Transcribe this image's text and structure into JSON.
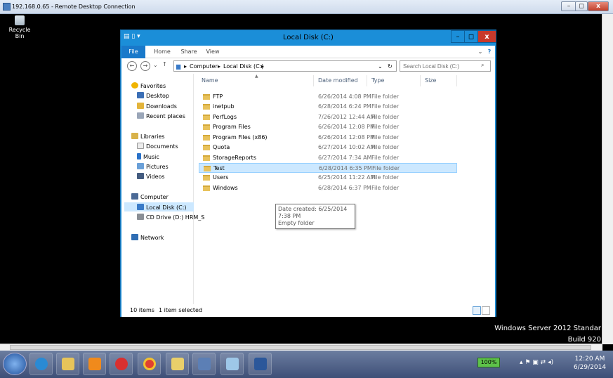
{
  "rdc": {
    "title": "192.168.0.65 - Remote Desktop Connection",
    "minimize": "–",
    "restore": "◻",
    "close": "x"
  },
  "desktop": {
    "recycle_bin": "Recycle Bin",
    "os_line1": "Windows Server 2012 Standar",
    "os_line2": "Build 920"
  },
  "explorer": {
    "title": "Local Disk (C:)",
    "minimize": "–",
    "maximize": "◻",
    "close": "x",
    "ribbon": {
      "file": "File",
      "home": "Home",
      "share": "Share",
      "view": "View"
    },
    "address": {
      "computer": "Computer",
      "disk": "Local Disk (C:)"
    },
    "search_placeholder": "Search Local Disk (C:)",
    "nav": {
      "favorites": "Favorites",
      "desktop": "Desktop",
      "downloads": "Downloads",
      "recent": "Recent places",
      "libraries": "Libraries",
      "documents": "Documents",
      "music": "Music",
      "pictures": "Pictures",
      "videos": "Videos",
      "computer": "Computer",
      "local_disk": "Local Disk (C:)",
      "cd_drive": "CD Drive (D:) HRM_S",
      "network": "Network"
    },
    "columns": {
      "name": "Name",
      "date": "Date modified",
      "type": "Type",
      "size": "Size"
    },
    "files": [
      {
        "name": "FTP",
        "date": "6/26/2014 4:08 PM",
        "type": "File folder"
      },
      {
        "name": "inetpub",
        "date": "6/28/2014 6:24 PM",
        "type": "File folder"
      },
      {
        "name": "PerfLogs",
        "date": "7/26/2012 12:44 AM",
        "type": "File folder"
      },
      {
        "name": "Program Files",
        "date": "6/26/2014 12:08 PM",
        "type": "File folder"
      },
      {
        "name": "Program Files (x86)",
        "date": "6/26/2014 12:08 PM",
        "type": "File folder"
      },
      {
        "name": "Quota",
        "date": "6/27/2014 10:02 AM",
        "type": "File folder"
      },
      {
        "name": "StorageReports",
        "date": "6/27/2014 7:34 AM",
        "type": "File folder"
      },
      {
        "name": "Test",
        "date": "6/28/2014 6:35 PM",
        "type": "File folder"
      },
      {
        "name": "Users",
        "date": "6/25/2014 11:22 AM",
        "type": "File folder"
      },
      {
        "name": "Windows",
        "date": "6/28/2014 6:37 PM",
        "type": "File folder"
      }
    ],
    "tooltip": {
      "line1": "Date created: 6/25/2014 7:38 PM",
      "line2": "Empty folder"
    },
    "status": {
      "count": "10 items",
      "selected": "1 item selected"
    }
  },
  "taskbar": {
    "battery": "100%",
    "time": "12:20 AM",
    "date": "6/29/2014"
  },
  "colors": {
    "explorer_frame": "#1b8ed8",
    "selection": "#cce8ff",
    "folder": "#e8c25c"
  }
}
